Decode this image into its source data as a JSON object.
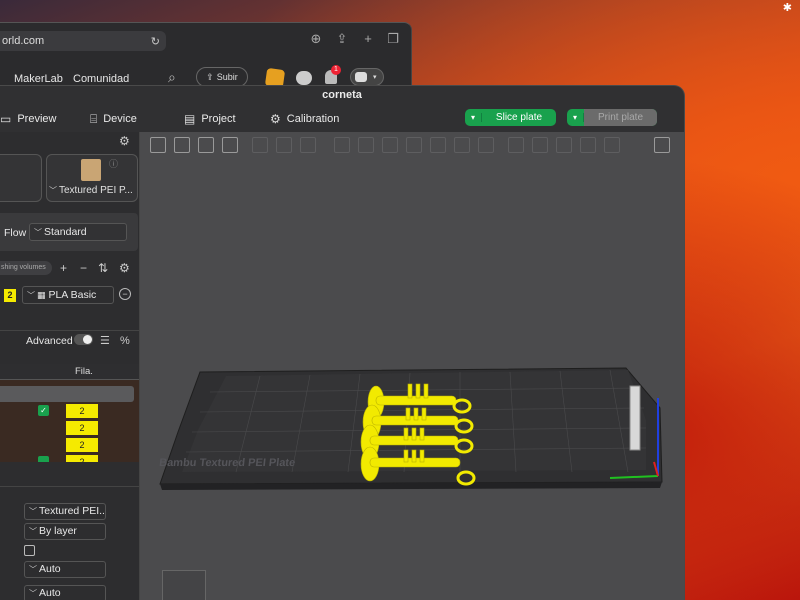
{
  "browser": {
    "url": "orld.com",
    "nav_links": [
      "MakerLab",
      "Comunidad"
    ],
    "upload_label": "Subir",
    "notification_count": "1"
  },
  "app": {
    "title": "corneta",
    "tabs": [
      {
        "label": "Preview",
        "icon": "preview-icon"
      },
      {
        "label": "Device",
        "icon": "device-icon"
      },
      {
        "label": "Project",
        "icon": "project-icon"
      },
      {
        "label": "Calibration",
        "icon": "calibration-icon"
      }
    ],
    "slice_label": "Slice plate",
    "print_label": "Print plate",
    "accent_color": "#19a14d"
  },
  "sidebar": {
    "plate_label": "Textured PEI P...",
    "flow_label": "Flow",
    "flow_value": "Standard",
    "flush_label": "shing volumes",
    "filament_number": "2",
    "filament_name": "PLA Basic",
    "filament_color": "#f5ea00",
    "advanced_label": "Advanced",
    "table_header_fila": "Fila.",
    "object_filaments": [
      "2",
      "2",
      "2",
      "2"
    ],
    "settings": [
      "Textured PEI...",
      "By layer",
      "Auto",
      "Auto"
    ]
  },
  "viewport": {
    "plate_label": "Bambu Textured PEI Plate",
    "model_color": "#f2ea00"
  }
}
